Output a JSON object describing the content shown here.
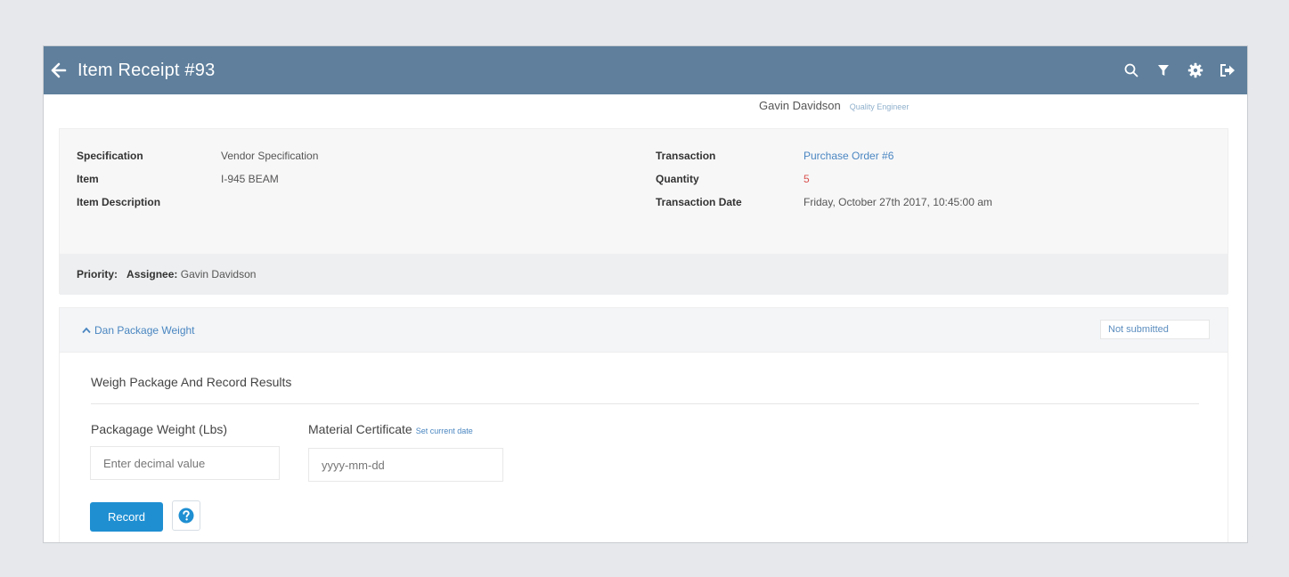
{
  "header": {
    "title": "Item Receipt #93"
  },
  "user": {
    "name": "Gavin Davidson",
    "role": "Quality Engineer"
  },
  "details": {
    "specification_label": "Specification",
    "specification_value": "Vendor Specification",
    "item_label": "Item",
    "item_value": "I-945 BEAM",
    "item_description_label": "Item Description",
    "transaction_label": "Transaction",
    "transaction_value": "Purchase Order #6",
    "quantity_label": "Quantity",
    "quantity_value": "5",
    "transaction_date_label": "Transaction Date",
    "transaction_date_value": "Friday, October 27th 2017, 10:45:00 am",
    "priority_label": "Priority:",
    "assignee_label": "Assignee:",
    "assignee_value": "Gavin Davidson"
  },
  "step": {
    "toggle_label": "Dan Package Weight",
    "status": "Not submitted",
    "title": "Weigh Package And Record Results",
    "weight_label": "Packagage Weight (Lbs)",
    "weight_placeholder": "Enter decimal value",
    "certificate_label": "Material Certificate",
    "set_date_link": "Set current date",
    "date_placeholder": "yyyy-mm-dd",
    "record_label": "Record"
  },
  "icons": {
    "back": "arrow-left-icon",
    "search": "search-icon",
    "filter": "filter-icon",
    "settings": "gear-icon",
    "logout": "sign-out-icon",
    "toggle": "chevron-up-icon",
    "help": "question-circle-icon"
  },
  "colors": {
    "topbar": "#5f7f9c",
    "accent": "#1f8fd2",
    "link": "#4a86c1",
    "quantity": "#d9534f"
  }
}
